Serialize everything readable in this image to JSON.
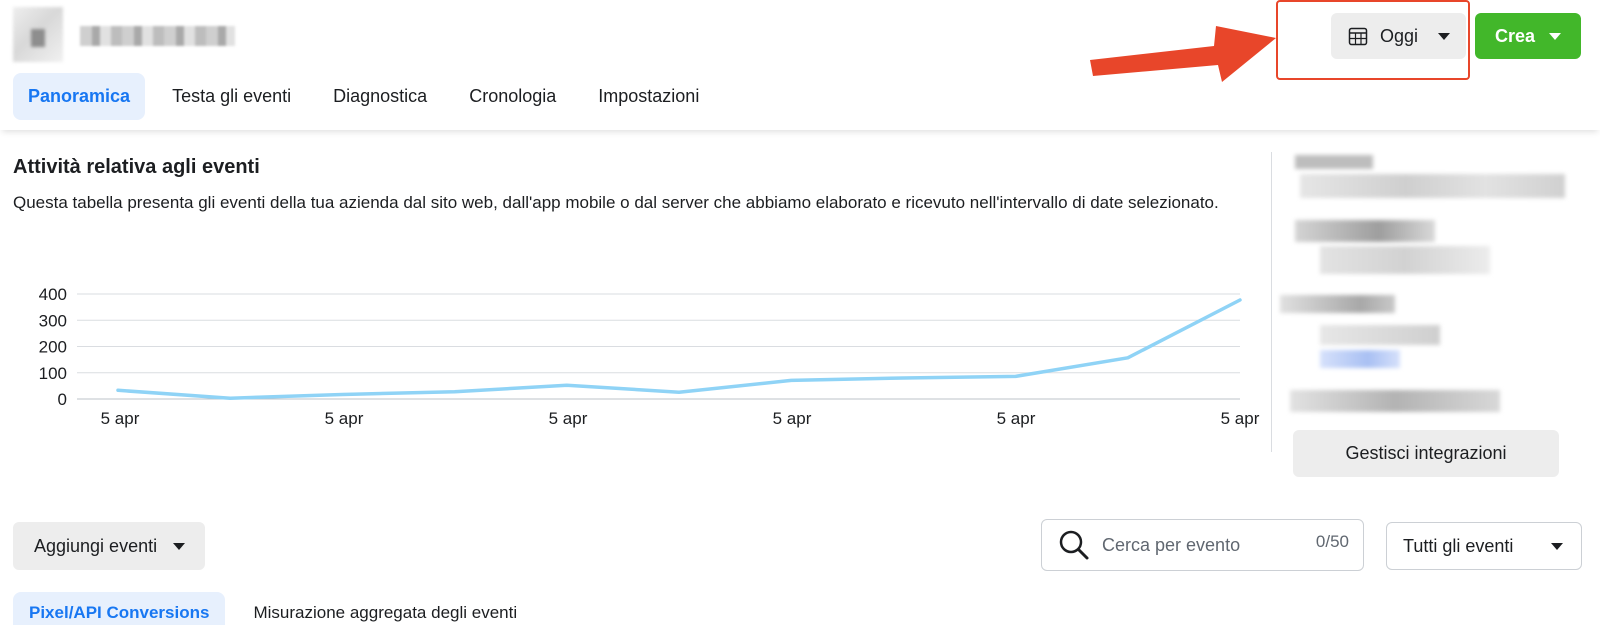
{
  "tabs": [
    {
      "label": "Panoramica",
      "active": true
    },
    {
      "label": "Testa gli eventi",
      "active": false
    },
    {
      "label": "Diagnostica",
      "active": false
    },
    {
      "label": "Cronologia",
      "active": false
    },
    {
      "label": "Impostazioni",
      "active": false
    }
  ],
  "header": {
    "date_label": "Oggi",
    "create_label": "Crea",
    "annotation_color": "#e8462a"
  },
  "activity": {
    "title": "Attività relativa agli eventi",
    "description": "Questa tabella presenta gli eventi della tua azienda dal sito web, dall'app mobile o dal server che abbiamo elaborato e ricevuto nell'intervallo di date selezionato."
  },
  "chart_data": {
    "type": "line",
    "title": "",
    "xlabel": "",
    "ylabel": "",
    "x_tick_labels": [
      "5 apr",
      "5 apr",
      "5 apr",
      "5 apr",
      "5 apr",
      "5 apr"
    ],
    "y_ticks": [
      0,
      100,
      200,
      300,
      400
    ],
    "ylim": [
      0,
      400
    ],
    "grid": true,
    "series": [
      {
        "color": "#8fd3f6",
        "values": [
          33,
          3,
          17,
          28,
          52,
          26,
          71,
          80,
          86,
          157,
          377
        ]
      }
    ]
  },
  "sidebar": {
    "manage_label": "Gestisci integrazioni"
  },
  "controls": {
    "add_events_label": "Aggiungi eventi",
    "search_placeholder": "Cerca per evento",
    "search_count": "0/50",
    "filter_label": "Tutti gli eventi"
  },
  "subtabs": [
    {
      "label": "Pixel/API Conversions",
      "active": true
    },
    {
      "label": "Misurazione aggregata degli eventi",
      "active": false
    }
  ]
}
